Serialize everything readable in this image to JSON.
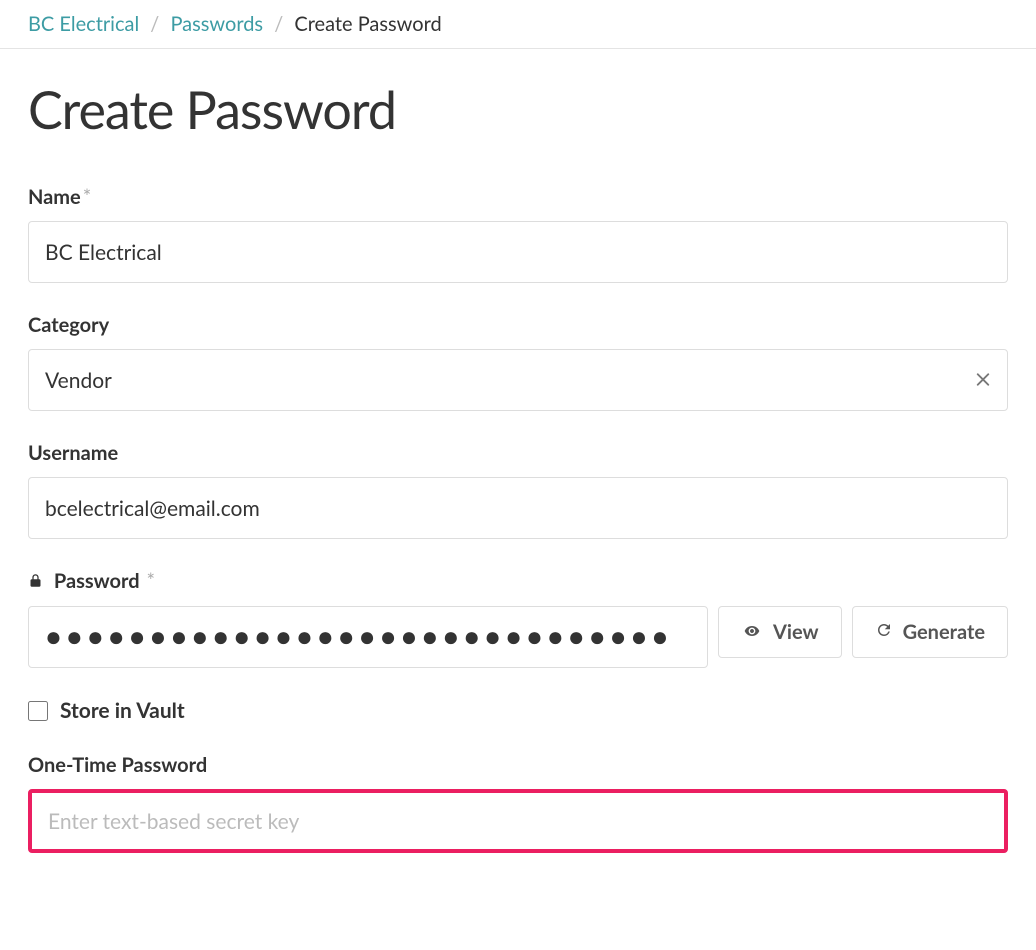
{
  "breadcrumb": {
    "item1": "BC Electrical",
    "item2": "Passwords",
    "current": "Create Password"
  },
  "page": {
    "title": "Create Password"
  },
  "form": {
    "name": {
      "label": "Name",
      "required": "*",
      "value": "BC Electrical"
    },
    "category": {
      "label": "Category",
      "value": "Vendor"
    },
    "username": {
      "label": "Username",
      "value": "bcelectrical@email.com"
    },
    "password": {
      "label": "Password",
      "required": "*",
      "value": "●●●●●●●●●●●●●●●●●●●●●●●●●●●●●●",
      "view_btn": "View",
      "generate_btn": "Generate"
    },
    "store_vault": {
      "label": "Store in Vault"
    },
    "otp": {
      "label": "One-Time Password",
      "placeholder": "Enter text-based secret key"
    }
  }
}
